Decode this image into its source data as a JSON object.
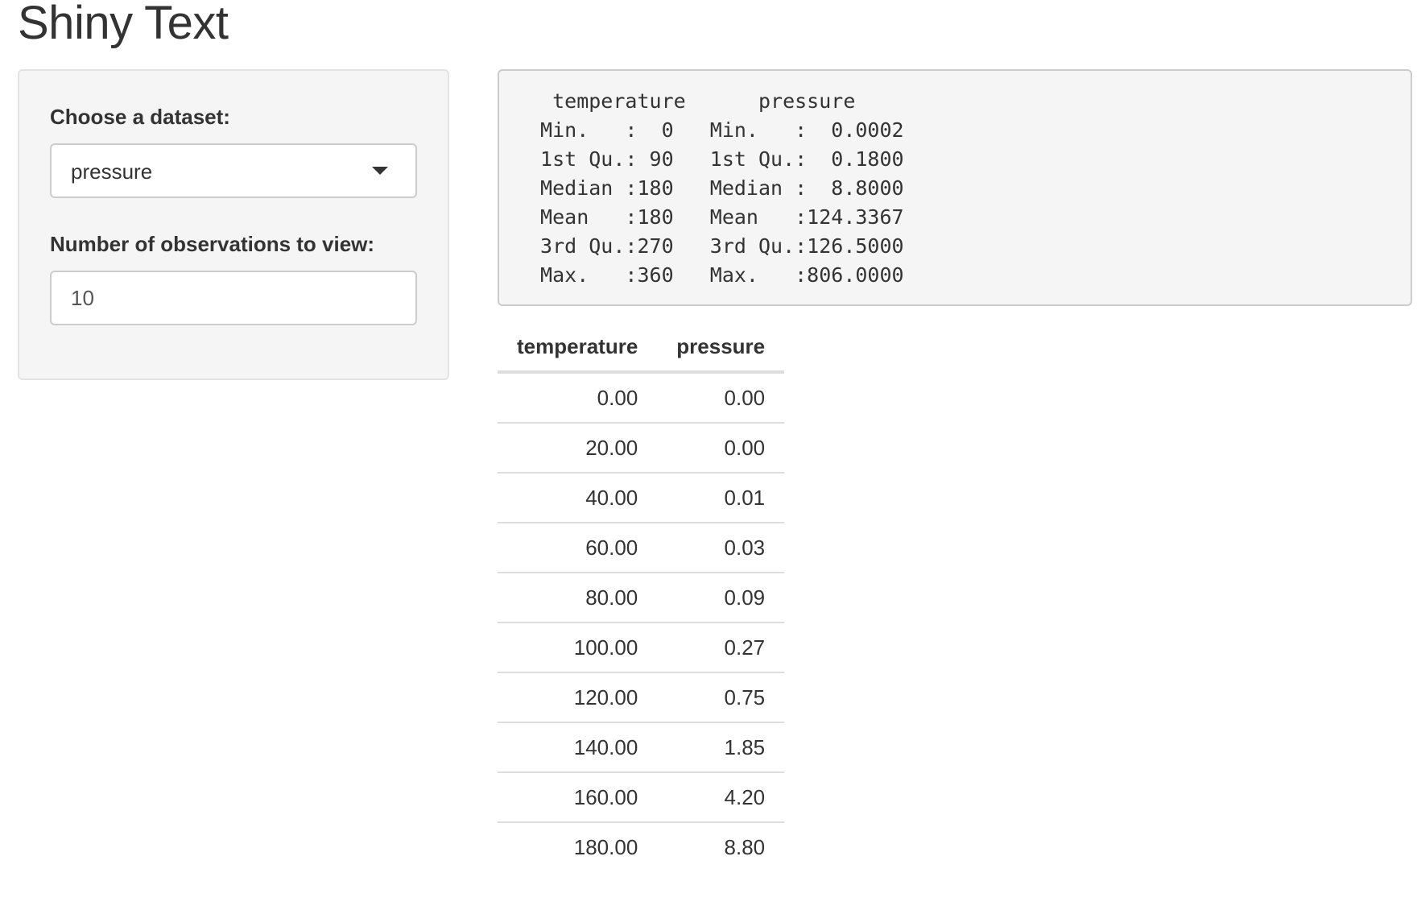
{
  "page": {
    "title": "Shiny Text"
  },
  "sidebar": {
    "dataset_label": "Choose a dataset:",
    "dataset_selected": "pressure",
    "obs_label": "Number of observations to view:",
    "obs_value": "10"
  },
  "summary": {
    "lines": [
      "  temperature      pressure     ",
      " Min.   :  0   Min.   :  0.0002  ",
      " 1st Qu.: 90   1st Qu.:  0.1800  ",
      " Median :180   Median :  8.8000  ",
      " Mean   :180   Mean   :124.3367  ",
      " 3rd Qu.:270   3rd Qu.:126.5000  ",
      " Max.   :360   Max.   :806.0000  "
    ]
  },
  "table": {
    "headers": [
      "temperature",
      "pressure"
    ],
    "rows": [
      [
        "0.00",
        "0.00"
      ],
      [
        "20.00",
        "0.00"
      ],
      [
        "40.00",
        "0.01"
      ],
      [
        "60.00",
        "0.03"
      ],
      [
        "80.00",
        "0.09"
      ],
      [
        "100.00",
        "0.27"
      ],
      [
        "120.00",
        "0.75"
      ],
      [
        "140.00",
        "1.85"
      ],
      [
        "160.00",
        "4.20"
      ],
      [
        "180.00",
        "8.80"
      ]
    ]
  },
  "icons": {
    "select_caret": "caret-down-icon"
  },
  "colors": {
    "text": "#333333",
    "panel_bg": "#f5f5f5",
    "border": "#cccccc"
  }
}
